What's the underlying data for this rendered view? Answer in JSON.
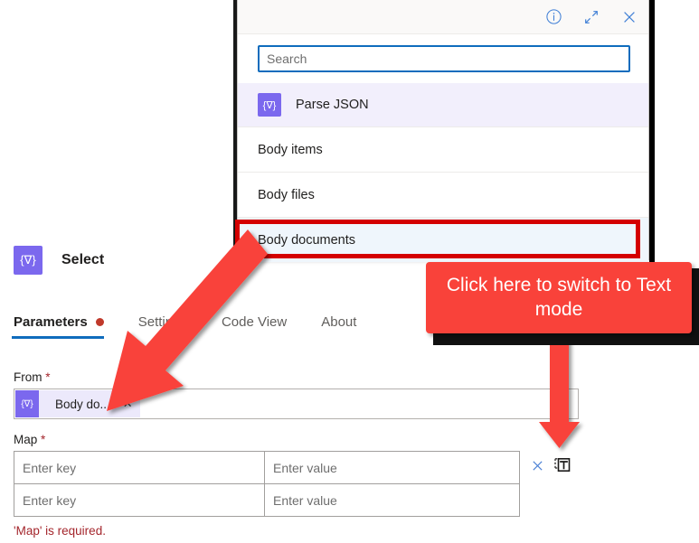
{
  "picker": {
    "actions": [
      {
        "name": "info-icon",
        "label": "Information"
      },
      {
        "name": "expand-icon",
        "label": "Expand"
      },
      {
        "name": "close-icon",
        "label": "Close"
      }
    ],
    "search": {
      "value": "",
      "placeholder": "Search"
    },
    "group": {
      "label": "Parse JSON",
      "icon": "parse-json-icon",
      "icon_glyph": "{∇}"
    },
    "items": [
      {
        "label": "Body items",
        "selected": false
      },
      {
        "label": "Body files",
        "selected": false
      },
      {
        "label": "Body documents",
        "selected": true
      }
    ]
  },
  "action_card": {
    "title": "Select",
    "icon_glyph": "{∇}",
    "tabs": [
      {
        "label": "Parameters",
        "active": true,
        "has_required_dot": true
      },
      {
        "label": "Settings",
        "active": false,
        "has_required_dot": false
      },
      {
        "label": "Code View",
        "active": false,
        "has_required_dot": false
      },
      {
        "label": "About",
        "active": false,
        "has_required_dot": false
      }
    ],
    "from": {
      "label": "From",
      "required_marker": "*",
      "token_text": "Body do...",
      "token_icon_glyph": "{∇}",
      "token_remove_glyph": "✕"
    },
    "map": {
      "label": "Map",
      "required_marker": "*",
      "rows": [
        {
          "key_placeholder": "Enter key",
          "value_placeholder": "Enter value"
        },
        {
          "key_placeholder": "Enter key",
          "value_placeholder": "Enter value"
        }
      ],
      "delete_icon": "close-icon",
      "text_mode_icon": "switch-to-text-mode-icon"
    },
    "error_message": "'Map' is required."
  },
  "annotations": {
    "callout_text": "Click here to switch to Text mode",
    "callout_color": "#f9423a",
    "highlight_color": "#d40000",
    "arrow_color": "#f9423a"
  }
}
